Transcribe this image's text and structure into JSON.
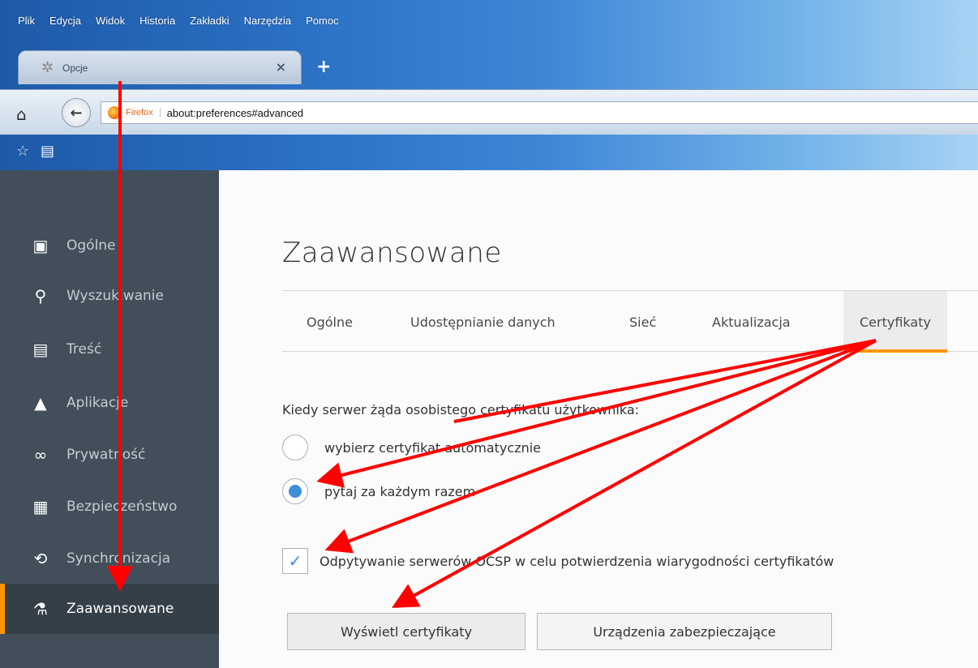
{
  "menubar": {
    "items": [
      "Plik",
      "Edycja",
      "Widok",
      "Historia",
      "Zakładki",
      "Narzędzia",
      "Pomoc"
    ]
  },
  "tabs": {
    "active_label": "Opcje",
    "close_glyph": "×",
    "new_tab_glyph": "+"
  },
  "navbar": {
    "identity_label": "Firefox",
    "url": "about:preferences#advanced"
  },
  "sidebar": {
    "items": [
      {
        "label": "Ogólne",
        "icon": "general-icon"
      },
      {
        "label": "Wyszukiwanie",
        "icon": "search-icon"
      },
      {
        "label": "Treść",
        "icon": "content-icon"
      },
      {
        "label": "Aplikacje",
        "icon": "applications-icon"
      },
      {
        "label": "Prywatność",
        "icon": "privacy-mask-icon"
      },
      {
        "label": "Bezpieczeństwo",
        "icon": "security-lock-icon"
      },
      {
        "label": "Synchronizacja",
        "icon": "sync-icon"
      },
      {
        "label": "Zaawansowane",
        "icon": "advanced-icon"
      }
    ],
    "active_index": 7
  },
  "content": {
    "title": "Zaawansowane",
    "subtabs": [
      "Ogólne",
      "Udostępnianie danych",
      "Sieć",
      "Aktualizacja",
      "Certyfikaty"
    ],
    "selected_subtab": "Certyfikaty",
    "cert_question": "Kiedy serwer żąda osobistego certyfikatu użytkownika:",
    "radio_auto": "wybierz certyfikat automatycznie",
    "radio_ask": "pytaj za każdym razem",
    "radio_selected": "ask",
    "ocsp_label": "Odpytywanie serwerów OCSP w celu potwierdzenia wiarygodności certyfikatów",
    "ocsp_checked": true,
    "btn_view_certs": "Wyświetl certyfikaty",
    "btn_security_devices": "Urządzenia zabezpieczające"
  },
  "colors": {
    "accent": "#ff9500",
    "sidebar_bg": "#424f5a",
    "radio_on": "#3d8fd8",
    "annotation": "#ff0000"
  }
}
